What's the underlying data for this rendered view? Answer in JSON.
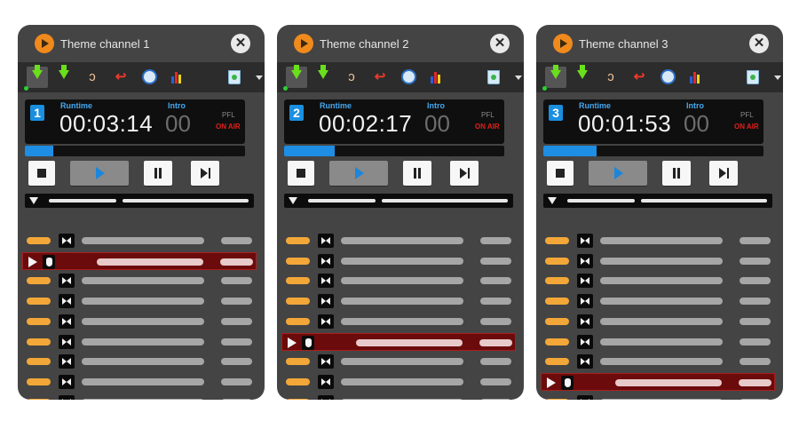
{
  "colors": {
    "panel_bg": "#444444",
    "accent_blue": "#1d8ee3",
    "on_air_red": "#e0201a",
    "active_row_bg": "#6b0b0b",
    "row_pill_orange": "#f3a738"
  },
  "toolbar_icons": [
    "load-down-icon",
    "download-icon",
    "ear-icon",
    "undo-icon",
    "clock-icon",
    "level-bars-icon",
    "trash-icon",
    "dropdown-arrow-icon"
  ],
  "channels": [
    {
      "title": "Theme channel 1",
      "close_symbol": "✕",
      "number": "1",
      "runtime_label": "Runtime",
      "runtime": "00:03:14",
      "intro_label": "Intro",
      "intro": "00",
      "pfl": "PFL",
      "on_air": "ON AIR",
      "progress": 0.13,
      "active_row": 1,
      "row_count": 9
    },
    {
      "title": "Theme channel 2",
      "close_symbol": "✕",
      "number": "2",
      "runtime_label": "Runtime",
      "runtime": "00:02:17",
      "intro_label": "Intro",
      "intro": "00",
      "pfl": "PFL",
      "on_air": "ON AIR",
      "progress": 0.23,
      "active_row": 5,
      "row_count": 9
    },
    {
      "title": "Theme channel 3",
      "close_symbol": "✕",
      "number": "3",
      "runtime_label": "Runtime",
      "runtime": "00:01:53",
      "intro_label": "Intro",
      "intro": "00",
      "pfl": "PFL",
      "on_air": "ON AIR",
      "progress": 0.24,
      "active_row": 7,
      "row_count": 9
    }
  ]
}
